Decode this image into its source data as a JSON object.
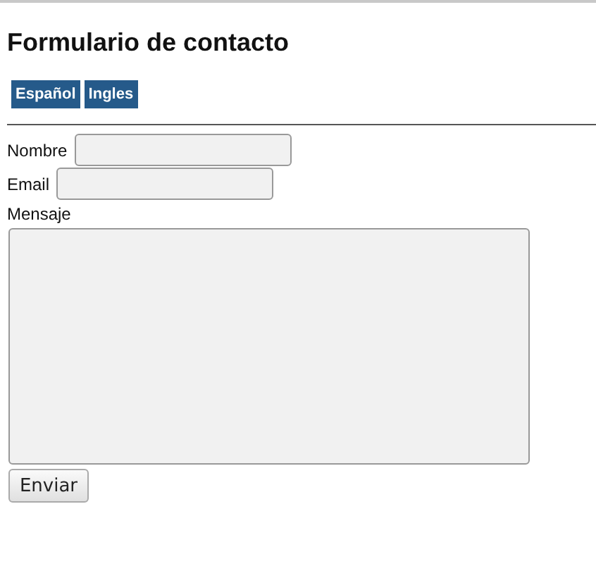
{
  "title": "Formulario de contacto",
  "language_buttons": [
    {
      "label": "Español"
    },
    {
      "label": "Ingles"
    }
  ],
  "fields": [
    {
      "label": "Nombre",
      "kind": "input"
    },
    {
      "label": "Email",
      "kind": "input"
    },
    {
      "label": "Mensaje",
      "kind": "textarea"
    }
  ],
  "submit": {
    "label": "Enviar"
  }
}
